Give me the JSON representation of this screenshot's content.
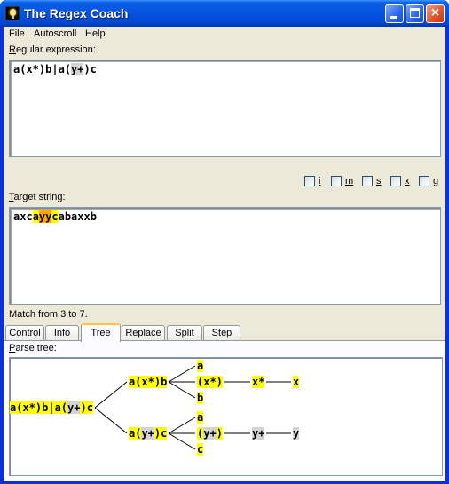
{
  "window": {
    "title": "The Regex Coach",
    "buttons": {
      "minimize": "minimize",
      "maximize": "maximize",
      "close": "×"
    }
  },
  "menu": [
    "File",
    "Autoscroll",
    "Help"
  ],
  "regex": {
    "label_accel": "R",
    "label_rest": "egular expression:",
    "segments": [
      {
        "text": "a(x*)b|a(",
        "hl": "none"
      },
      {
        "text": "y+",
        "hl": "gray"
      },
      {
        "text": ")c",
        "hl": "none"
      }
    ]
  },
  "flags": [
    {
      "key": "i",
      "checked": false
    },
    {
      "key": "m",
      "checked": false
    },
    {
      "key": "s",
      "checked": false
    },
    {
      "key": "x",
      "checked": false
    },
    {
      "key": "g",
      "checked": false
    }
  ],
  "target": {
    "label_accel": "T",
    "label_rest": "arget string:",
    "segments": [
      {
        "text": "axc",
        "hl": "none"
      },
      {
        "text": "a",
        "hl": "yellow"
      },
      {
        "text": "yy",
        "hl": "orange"
      },
      {
        "text": "c",
        "hl": "yellow"
      },
      {
        "text": "abaxxb",
        "hl": "none"
      }
    ]
  },
  "status": "Match from 3 to 7.",
  "tabs": [
    {
      "label": "Control",
      "active": false
    },
    {
      "label": "Info",
      "active": false
    },
    {
      "label": "Tree",
      "active": true
    },
    {
      "label": "Replace",
      "active": false
    },
    {
      "label": "Split",
      "active": false
    },
    {
      "label": "Step",
      "active": false
    }
  ],
  "parse_tree": {
    "label_accel": "P",
    "label_rest": "arse tree:",
    "nodes": {
      "root": [
        {
          "text": "a(x*)b|a(",
          "hl": "yellow"
        },
        {
          "text": "y+",
          "hl": "gray"
        },
        {
          "text": ")c",
          "hl": "yellow"
        }
      ],
      "alt1": [
        {
          "text": "a(x*)b",
          "hl": "yellow"
        }
      ],
      "alt2": [
        {
          "text": "a(",
          "hl": "yellow"
        },
        {
          "text": "y+",
          "hl": "gray"
        },
        {
          "text": ")c",
          "hl": "yellow"
        }
      ],
      "a1": [
        {
          "text": "a",
          "hl": "yellow"
        }
      ],
      "grp1": [
        {
          "text": "(x*)",
          "hl": "yellow"
        }
      ],
      "b1": [
        {
          "text": "b",
          "hl": "yellow"
        }
      ],
      "xstar": [
        {
          "text": "x*",
          "hl": "yellow"
        }
      ],
      "x": [
        {
          "text": "x",
          "hl": "yellow"
        }
      ],
      "a2": [
        {
          "text": "a",
          "hl": "yellow"
        }
      ],
      "grp2": [
        {
          "text": "(",
          "hl": "yellow"
        },
        {
          "text": "y+",
          "hl": "gray"
        },
        {
          "text": ")",
          "hl": "yellow"
        }
      ],
      "c2": [
        {
          "text": "c",
          "hl": "yellow"
        }
      ],
      "yplus": [
        {
          "text": "y+",
          "hl": "gray"
        }
      ],
      "y": [
        {
          "text": "y",
          "hl": "gray"
        }
      ]
    }
  }
}
